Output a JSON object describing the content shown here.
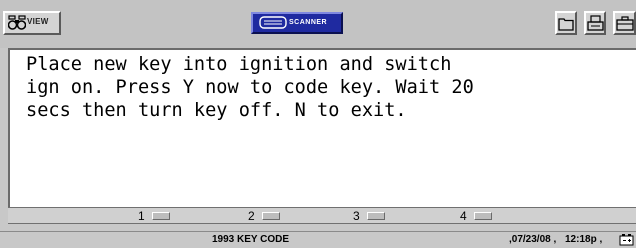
{
  "toolbar": {
    "view_label": "VIEW",
    "scanner_label": "SCANNER",
    "icons": [
      "binoculars-icon",
      "scanner-icon",
      "folder-icon",
      "printer-icon",
      "toolbox-icon"
    ]
  },
  "message": {
    "text": "Place new key into ignition and switch\nign on. Press Y now to code key. Wait 20\nsecs then turn key off. N to exit."
  },
  "function_keys": [
    {
      "number": "1"
    },
    {
      "number": "2"
    },
    {
      "number": "3"
    },
    {
      "number": "4"
    }
  ],
  "status": {
    "title": "1993 KEY CODE",
    "date": ",07/23/08 ,",
    "time": "12:18p ,"
  },
  "colors": {
    "scanner_button": "#1f2aa0",
    "panel_background": "#ffffff",
    "chrome": "#c8c8c8"
  }
}
